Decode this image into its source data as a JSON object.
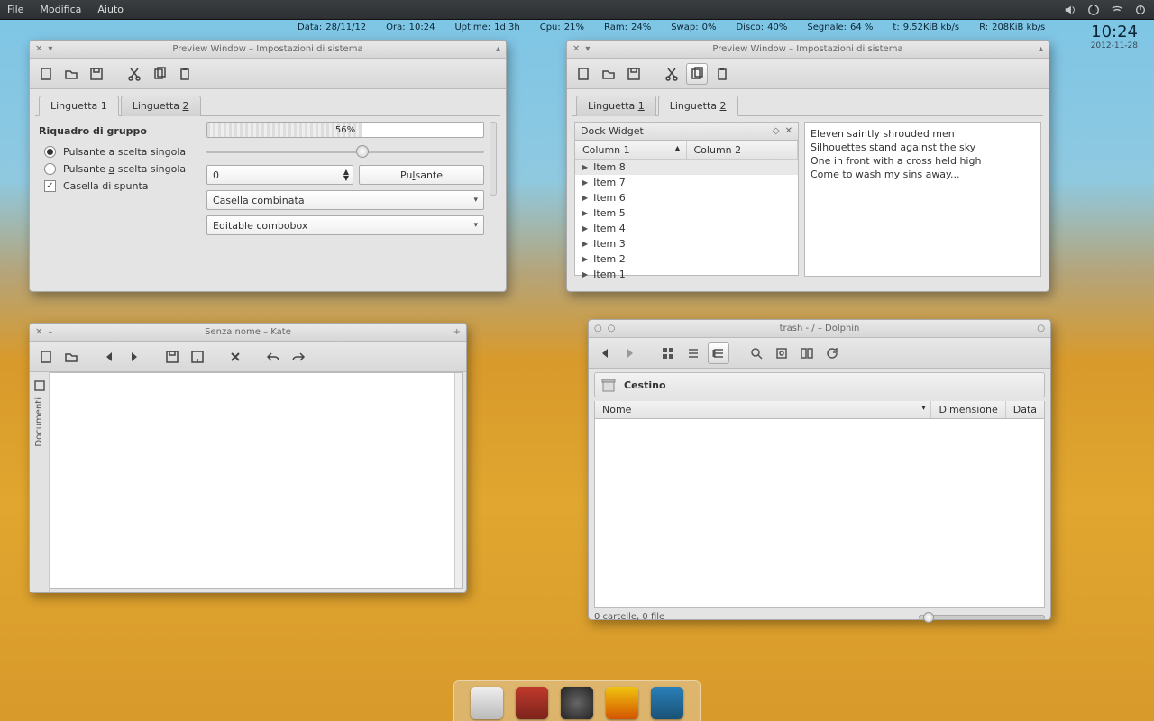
{
  "menubar": {
    "file": "File",
    "edit": "Modifica",
    "help": "Aiuto"
  },
  "stats": {
    "data_l": "Data:",
    "data_v": "28/11/12",
    "ora_l": "Ora:",
    "ora_v": "10:24",
    "uptime_l": "Uptime:",
    "uptime_v": "1d 3h",
    "cpu_l": "Cpu:",
    "cpu_v": "21%",
    "ram_l": "Ram:",
    "ram_v": "24%",
    "swap_l": "Swap:",
    "swap_v": "0%",
    "disco_l": "Disco:",
    "disco_v": "40%",
    "segnale_l": "Segnale:",
    "segnale_v": "64 %",
    "tx_l": "t:",
    "tx_v": "9.52KiB kb/s",
    "rx_l": "R:",
    "rx_v": "208KiB kb/s"
  },
  "clock": {
    "time": "10:24",
    "date": "2012-11-28"
  },
  "win1": {
    "title": "Preview Window – Impostazioni di sistema",
    "tab1": "Linguetta 1",
    "tab2": "Linguetta 2",
    "group": "Riquadro di gruppo",
    "radio1": "Pulsante a scelta singola",
    "radio2": "Pulsante a scelta singola",
    "check": "Casella di spunta",
    "progress": "56%",
    "spin": "0",
    "button": "Pulsante",
    "combo": "Casella combinata",
    "ecombo": "Editable combobox"
  },
  "win2": {
    "title": "Preview Window – Impostazioni di sistema",
    "tab1": "Linguetta 1",
    "tab2": "Linguetta 2",
    "dock": "Dock Widget",
    "col1": "Column 1",
    "col2": "Column 2",
    "items": [
      "Item 8",
      "Item 7",
      "Item 6",
      "Item 5",
      "Item 4",
      "Item 3",
      "Item 2",
      "Item 1"
    ],
    "text": [
      "Eleven saintly shrouded men",
      "Silhouettes stand against the sky",
      "One in front with a cross held high",
      "Come to wash my sins away..."
    ]
  },
  "kate": {
    "title": "Senza nome – Kate",
    "side": "Documenti"
  },
  "dolphin": {
    "title": "trash - / – Dolphin",
    "loc": "Cestino",
    "c_name": "Nome",
    "c_size": "Dimensione",
    "c_date": "Data",
    "status": "0 cartelle, 0 file"
  }
}
